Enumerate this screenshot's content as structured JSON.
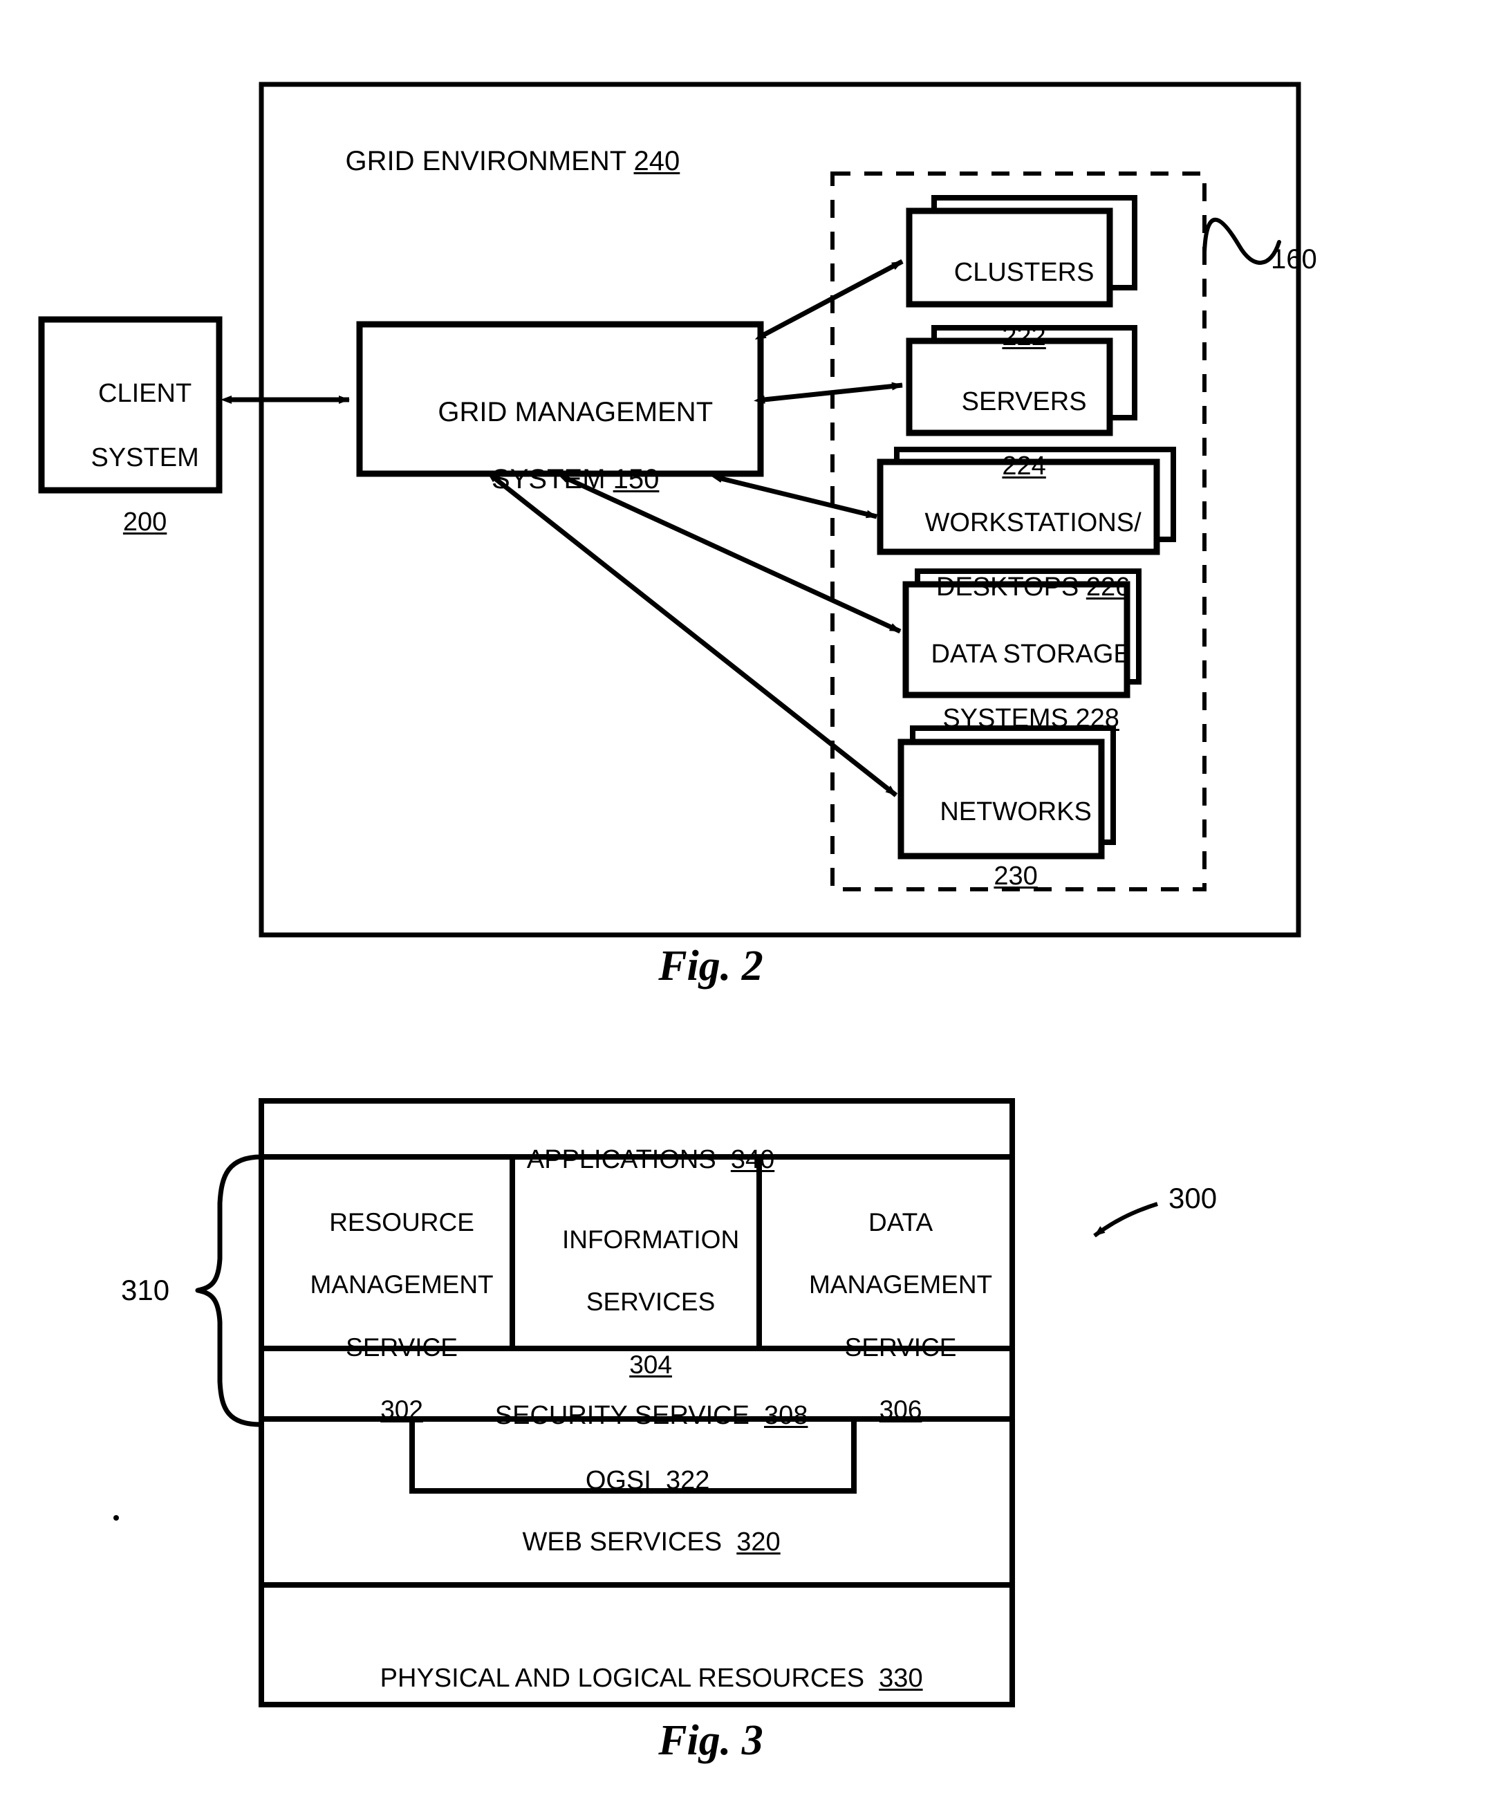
{
  "figures": [
    {
      "id": "fig2",
      "caption": "Fig. 2",
      "container_label": "GRID ENVIRONMENT",
      "container_ref": "240",
      "boundary_label": "160",
      "nodes": [
        {
          "name": "client-system",
          "line1": "CLIENT",
          "line2": "SYSTEM",
          "ref": "200"
        },
        {
          "name": "grid-management-system",
          "line1": "GRID MANAGEMENT",
          "line2": "SYSTEM",
          "ref": "150"
        }
      ],
      "resources": [
        {
          "name": "clusters",
          "line1": "CLUSTERS",
          "line2": "",
          "ref": "222"
        },
        {
          "name": "servers",
          "line1": "SERVERS",
          "line2": "",
          "ref": "224"
        },
        {
          "name": "workstations-desktops",
          "line1": "WORKSTATIONS/",
          "line2": "DESKTOPS",
          "ref": "226"
        },
        {
          "name": "data-storage-systems",
          "line1": "DATA STORAGE",
          "line2": "SYSTEMS",
          "ref": "228"
        },
        {
          "name": "networks",
          "line1": "NETWORKS",
          "line2": "",
          "ref": "230"
        }
      ]
    },
    {
      "id": "fig3",
      "caption": "Fig. 3",
      "stack_label": "300",
      "brace_label": "310",
      "rows": {
        "applications": {
          "label": "APPLICATIONS",
          "ref": "340"
        },
        "services": [
          {
            "name": "resource-management-service",
            "line1": "RESOURCE",
            "line2": "MANAGEMENT",
            "line3": "SERVICE",
            "ref": "302"
          },
          {
            "name": "information-services",
            "line1": "INFORMATION",
            "line2": "SERVICES",
            "line3": "",
            "ref": "304"
          },
          {
            "name": "data-management-service",
            "line1": "DATA",
            "line2": "MANAGEMENT",
            "line3": "SERVICE",
            "ref": "306"
          }
        ],
        "security": {
          "label": "SECURITY SERVICE",
          "ref": "308"
        },
        "ogsi": {
          "label": "OGSI",
          "ref": "322"
        },
        "web_services": {
          "label": "WEB SERVICES",
          "ref": "320"
        },
        "physical": {
          "label": "PHYSICAL AND LOGICAL RESOURCES",
          "ref": "330"
        }
      }
    }
  ],
  "colors": {
    "ink": "#000000",
    "paper": "#ffffff"
  }
}
